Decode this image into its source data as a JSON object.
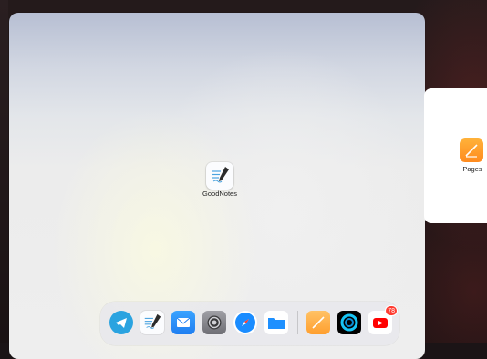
{
  "switcher": {
    "main_card": {
      "app_label": "GoodNotes",
      "icon": "goodnotes-icon"
    },
    "right_card": {
      "app_label": "Pages",
      "icon": "pages-icon"
    }
  },
  "dock": {
    "items": [
      {
        "name": "Telegram",
        "icon": "telegram-icon",
        "color": "#2aa3e0"
      },
      {
        "name": "GoodNotes",
        "icon": "goodnotes-icon",
        "color": "#fbfcfe"
      },
      {
        "name": "Mail",
        "icon": "mail-icon",
        "color": "#1f8ef1"
      },
      {
        "name": "Settings",
        "icon": "settings-icon",
        "color": "#8e8e93"
      },
      {
        "name": "Safari",
        "icon": "safari-icon",
        "color": "#1a8cff"
      },
      {
        "name": "Files",
        "icon": "files-icon",
        "color": "#1e90ff"
      },
      {
        "name": "Pages",
        "icon": "pages-icon",
        "color": "#ff9f2e"
      },
      {
        "name": "Fitness",
        "icon": "fitness-icon",
        "color": "#000000"
      },
      {
        "name": "YouTube",
        "icon": "youtube-icon",
        "color": "#ff0000",
        "badge": "78"
      }
    ]
  }
}
